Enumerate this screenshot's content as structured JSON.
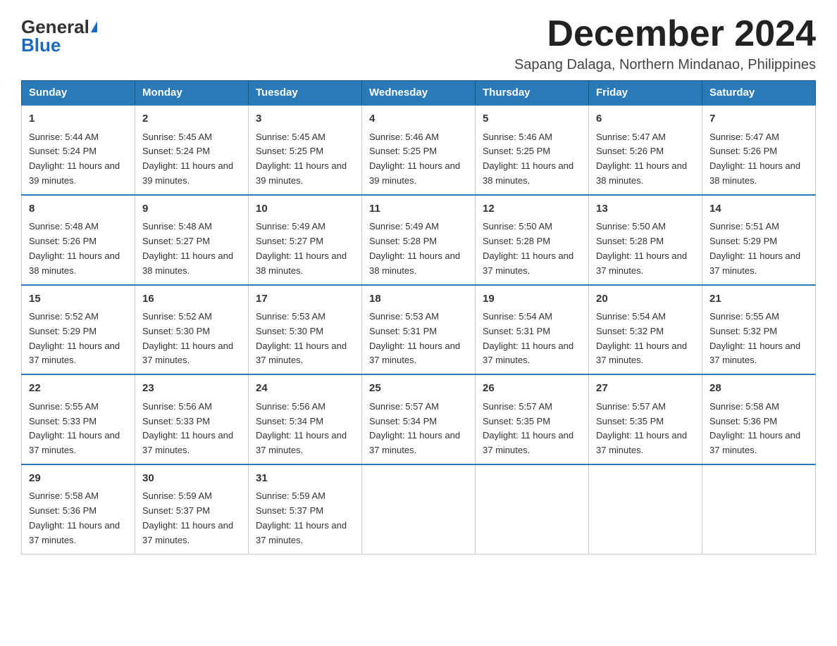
{
  "header": {
    "logo_general": "General",
    "logo_blue": "Blue",
    "month_title": "December 2024",
    "subtitle": "Sapang Dalaga, Northern Mindanao, Philippines"
  },
  "weekdays": [
    "Sunday",
    "Monday",
    "Tuesday",
    "Wednesday",
    "Thursday",
    "Friday",
    "Saturday"
  ],
  "weeks": [
    [
      {
        "day": "1",
        "sunrise": "5:44 AM",
        "sunset": "5:24 PM",
        "daylight": "11 hours and 39 minutes."
      },
      {
        "day": "2",
        "sunrise": "5:45 AM",
        "sunset": "5:24 PM",
        "daylight": "11 hours and 39 minutes."
      },
      {
        "day": "3",
        "sunrise": "5:45 AM",
        "sunset": "5:25 PM",
        "daylight": "11 hours and 39 minutes."
      },
      {
        "day": "4",
        "sunrise": "5:46 AM",
        "sunset": "5:25 PM",
        "daylight": "11 hours and 39 minutes."
      },
      {
        "day": "5",
        "sunrise": "5:46 AM",
        "sunset": "5:25 PM",
        "daylight": "11 hours and 38 minutes."
      },
      {
        "day": "6",
        "sunrise": "5:47 AM",
        "sunset": "5:26 PM",
        "daylight": "11 hours and 38 minutes."
      },
      {
        "day": "7",
        "sunrise": "5:47 AM",
        "sunset": "5:26 PM",
        "daylight": "11 hours and 38 minutes."
      }
    ],
    [
      {
        "day": "8",
        "sunrise": "5:48 AM",
        "sunset": "5:26 PM",
        "daylight": "11 hours and 38 minutes."
      },
      {
        "day": "9",
        "sunrise": "5:48 AM",
        "sunset": "5:27 PM",
        "daylight": "11 hours and 38 minutes."
      },
      {
        "day": "10",
        "sunrise": "5:49 AM",
        "sunset": "5:27 PM",
        "daylight": "11 hours and 38 minutes."
      },
      {
        "day": "11",
        "sunrise": "5:49 AM",
        "sunset": "5:28 PM",
        "daylight": "11 hours and 38 minutes."
      },
      {
        "day": "12",
        "sunrise": "5:50 AM",
        "sunset": "5:28 PM",
        "daylight": "11 hours and 37 minutes."
      },
      {
        "day": "13",
        "sunrise": "5:50 AM",
        "sunset": "5:28 PM",
        "daylight": "11 hours and 37 minutes."
      },
      {
        "day": "14",
        "sunrise": "5:51 AM",
        "sunset": "5:29 PM",
        "daylight": "11 hours and 37 minutes."
      }
    ],
    [
      {
        "day": "15",
        "sunrise": "5:52 AM",
        "sunset": "5:29 PM",
        "daylight": "11 hours and 37 minutes."
      },
      {
        "day": "16",
        "sunrise": "5:52 AM",
        "sunset": "5:30 PM",
        "daylight": "11 hours and 37 minutes."
      },
      {
        "day": "17",
        "sunrise": "5:53 AM",
        "sunset": "5:30 PM",
        "daylight": "11 hours and 37 minutes."
      },
      {
        "day": "18",
        "sunrise": "5:53 AM",
        "sunset": "5:31 PM",
        "daylight": "11 hours and 37 minutes."
      },
      {
        "day": "19",
        "sunrise": "5:54 AM",
        "sunset": "5:31 PM",
        "daylight": "11 hours and 37 minutes."
      },
      {
        "day": "20",
        "sunrise": "5:54 AM",
        "sunset": "5:32 PM",
        "daylight": "11 hours and 37 minutes."
      },
      {
        "day": "21",
        "sunrise": "5:55 AM",
        "sunset": "5:32 PM",
        "daylight": "11 hours and 37 minutes."
      }
    ],
    [
      {
        "day": "22",
        "sunrise": "5:55 AM",
        "sunset": "5:33 PM",
        "daylight": "11 hours and 37 minutes."
      },
      {
        "day": "23",
        "sunrise": "5:56 AM",
        "sunset": "5:33 PM",
        "daylight": "11 hours and 37 minutes."
      },
      {
        "day": "24",
        "sunrise": "5:56 AM",
        "sunset": "5:34 PM",
        "daylight": "11 hours and 37 minutes."
      },
      {
        "day": "25",
        "sunrise": "5:57 AM",
        "sunset": "5:34 PM",
        "daylight": "11 hours and 37 minutes."
      },
      {
        "day": "26",
        "sunrise": "5:57 AM",
        "sunset": "5:35 PM",
        "daylight": "11 hours and 37 minutes."
      },
      {
        "day": "27",
        "sunrise": "5:57 AM",
        "sunset": "5:35 PM",
        "daylight": "11 hours and 37 minutes."
      },
      {
        "day": "28",
        "sunrise": "5:58 AM",
        "sunset": "5:36 PM",
        "daylight": "11 hours and 37 minutes."
      }
    ],
    [
      {
        "day": "29",
        "sunrise": "5:58 AM",
        "sunset": "5:36 PM",
        "daylight": "11 hours and 37 minutes."
      },
      {
        "day": "30",
        "sunrise": "5:59 AM",
        "sunset": "5:37 PM",
        "daylight": "11 hours and 37 minutes."
      },
      {
        "day": "31",
        "sunrise": "5:59 AM",
        "sunset": "5:37 PM",
        "daylight": "11 hours and 37 minutes."
      },
      null,
      null,
      null,
      null
    ]
  ],
  "labels": {
    "sunrise_prefix": "Sunrise: ",
    "sunset_prefix": "Sunset: ",
    "daylight_prefix": "Daylight: "
  }
}
